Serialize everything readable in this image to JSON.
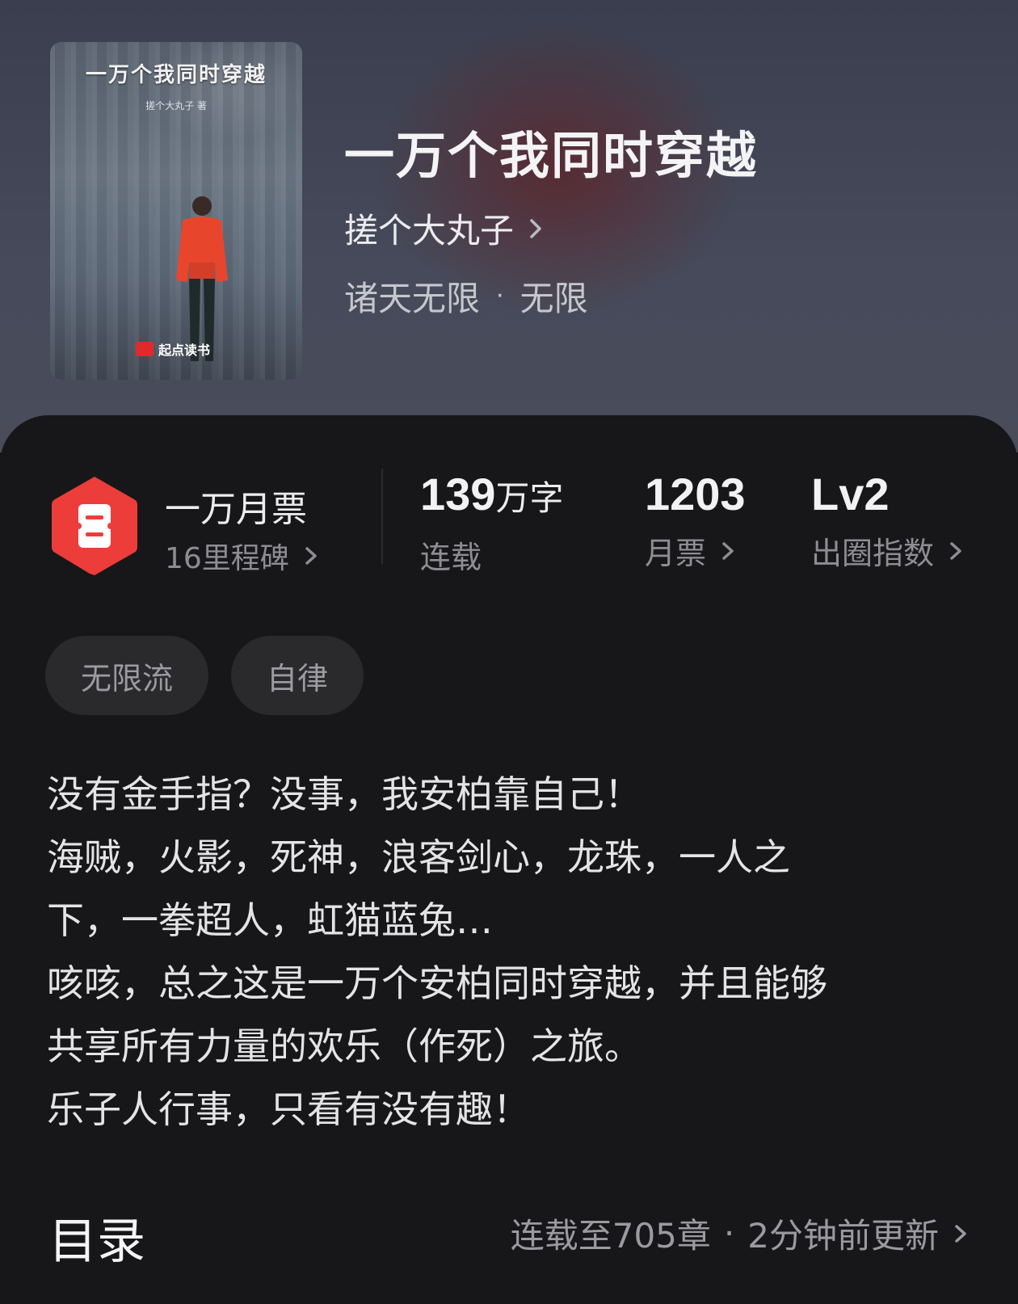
{
  "book": {
    "cover": {
      "title": "一万个我同时穿越",
      "author": "搓个大丸子 著",
      "brand": "起点读书"
    },
    "title": "一万个我同时穿越",
    "author": "搓个大丸子",
    "genre_primary": "诸天无限",
    "genre_separator": "·",
    "genre_secondary": "无限"
  },
  "stats": {
    "ticket": {
      "title": "一万月票",
      "subtitle": "16里程碑"
    },
    "words": {
      "value": "139",
      "unit": "万字",
      "label": "连载"
    },
    "monthly": {
      "value": "1203",
      "label": "月票"
    },
    "level": {
      "value": "Lv2",
      "label": "出圈指数"
    }
  },
  "tags": [
    "无限流",
    "自律"
  ],
  "synopsis": [
    "没有金手指？没事，我安柏靠自己！",
    "海贼，火影，死神，浪客剑心，龙珠，一人之",
    "下，一拳超人，虹猫蓝兔…",
    "咳咳，总之这是一万个安柏同时穿越，并且能够",
    "共享所有力量的欢乐（作死）之旅。",
    "乐子人行事，只看有没有趣！"
  ],
  "toc": {
    "title": "目录",
    "status": "连载至705章",
    "separator": "·",
    "updated": "2分钟前更新"
  },
  "colors": {
    "ticket_icon": "#ec3d3a",
    "panel_bg": "#17171a",
    "tag_bg": "#2a2a2d"
  }
}
